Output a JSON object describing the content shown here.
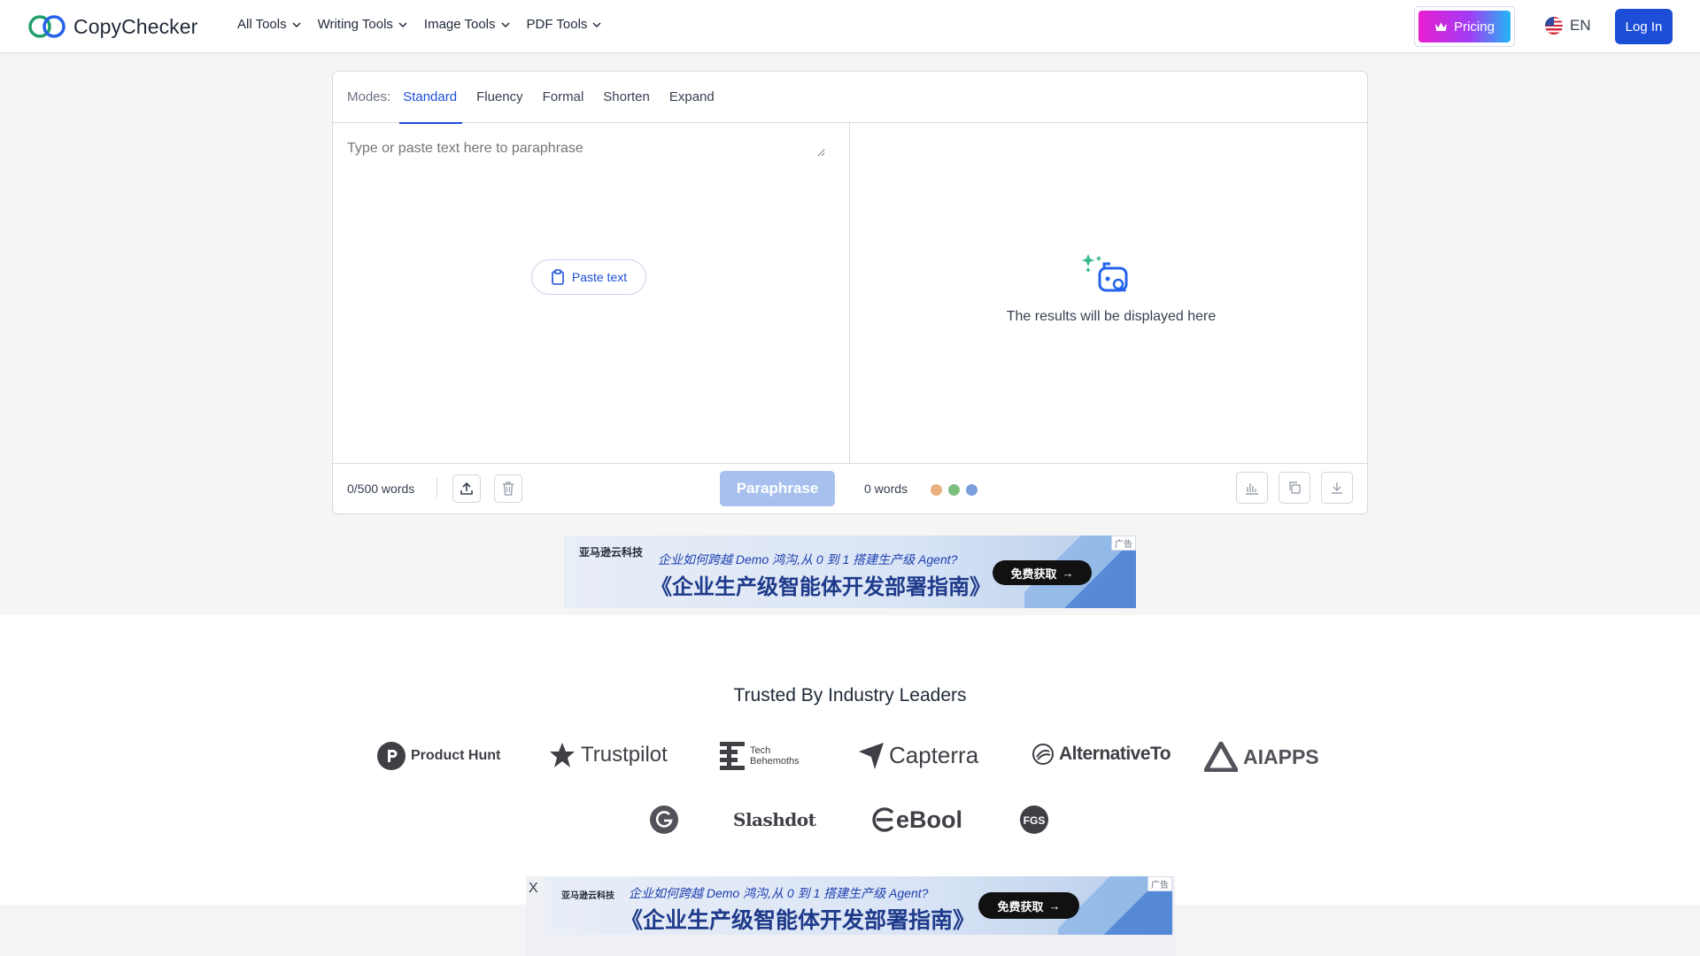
{
  "nav": {
    "brand": "CopyChecker",
    "menu": [
      {
        "label": "All Tools"
      },
      {
        "label": "Writing Tools"
      },
      {
        "label": "Image Tools"
      },
      {
        "label": "PDF Tools"
      }
    ],
    "pricing_label": "Pricing",
    "language": "EN",
    "login_label": "Log In"
  },
  "editor": {
    "modes_label": "Modes:",
    "modes": [
      {
        "label": "Standard",
        "active": true
      },
      {
        "label": "Fluency",
        "active": false
      },
      {
        "label": "Formal",
        "active": false
      },
      {
        "label": "Shorten",
        "active": false
      },
      {
        "label": "Expand",
        "active": false
      }
    ],
    "input_placeholder": "Type or paste text here to paraphrase",
    "paste_label": "Paste text",
    "result_placeholder": "The results will be displayed here",
    "input_word_count": "0/500 words",
    "paraphrase_label": "Paraphrase",
    "output_word_count": "0 words",
    "status_dot_colors": [
      "#e8b07c",
      "#7cbf7c",
      "#7a9fdc"
    ]
  },
  "ads": {
    "top": {
      "brand": "亚马逊云科技",
      "subtitle": "企业如何跨越 Demo 鸿沟,从 0 到 1 搭建生产级 Agent?",
      "title": "《企业生产级智能体开发部署指南》",
      "cta": "免费获取",
      "badge": "广告"
    },
    "bottom": {
      "brand": "亚马逊云科技",
      "subtitle": "企业如何跨越 Demo 鸿沟,从 0 到 1 搭建生产级 Agent?",
      "title": "《企业生产级智能体开发部署指南》",
      "cta": "免费获取",
      "badge": "广告",
      "close": "X"
    }
  },
  "trusted": {
    "title": "Trusted By Industry Leaders",
    "row1": [
      {
        "name": "Product Hunt",
        "icon": "product-hunt-icon"
      },
      {
        "name": "Trustpilot",
        "icon": "star-icon"
      },
      {
        "name": "Tech",
        "name2": "Behemoths",
        "icon": "tech-behemoths-icon"
      },
      {
        "name": "Capterra",
        "icon": "capterra-icon"
      },
      {
        "name": "AlternativeTo",
        "icon": "alternativeto-icon"
      },
      {
        "name": "AIAPPS",
        "icon": "aiapps-icon"
      }
    ],
    "row2": [
      {
        "name": "",
        "icon": "g2-icon"
      },
      {
        "name": "Slashdot",
        "icon": ""
      },
      {
        "name": "eBool",
        "icon": "ebool-icon"
      },
      {
        "name": "",
        "icon": "fgs-icon"
      }
    ]
  }
}
